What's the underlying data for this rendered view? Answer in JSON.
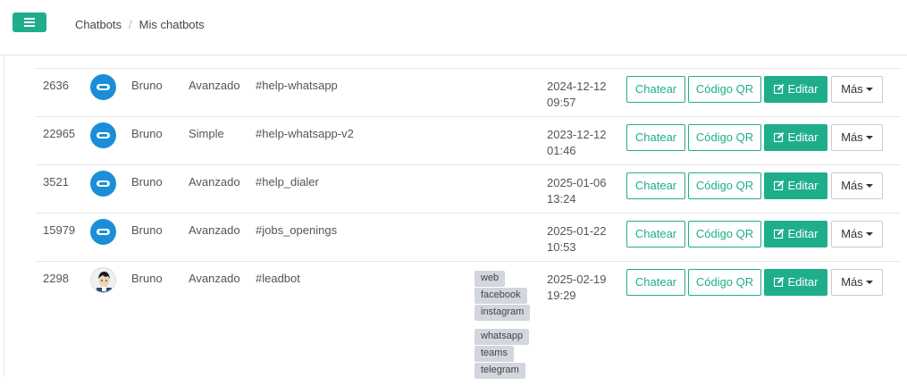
{
  "breadcrumb": {
    "root": "Chatbots",
    "sep": "/",
    "current": "Mis chatbots"
  },
  "buttons": {
    "chat": "Chatear",
    "qr": "Código QR",
    "edit": "Editar",
    "more": "Más"
  },
  "rows": [
    {
      "id": "2636",
      "user": "Bruno",
      "type": "Avanzado",
      "name": "#help-whatsapp",
      "date": "2024-12-12",
      "time": "09:57",
      "avatar": "bot-icon"
    },
    {
      "id": "22965",
      "user": "Bruno",
      "type": "Simple",
      "name": "#help-whatsapp-v2",
      "date": "2023-12-12",
      "time": "01:46",
      "avatar": "bot-icon"
    },
    {
      "id": "3521",
      "user": "Bruno",
      "type": "Avanzado",
      "name": "#help_dialer",
      "date": "2025-01-06",
      "time": "13:24",
      "avatar": "bot-icon"
    },
    {
      "id": "15979",
      "user": "Bruno",
      "type": "Avanzado",
      "name": "#jobs_openings",
      "date": "2025-01-22",
      "time": "10:53",
      "avatar": "bot-icon"
    },
    {
      "id": "2298",
      "user": "Bruno",
      "type": "Avanzado",
      "name": "#leadbot",
      "date": "2025-02-19",
      "time": "19:29",
      "avatar": "person-avatar",
      "tags": [
        "web",
        "facebook",
        "instagram",
        "whatsapp",
        "teams",
        "telegram"
      ]
    }
  ],
  "colors": {
    "accent": "#1fae8c",
    "bot": "#1a8fd6",
    "tag": "#d2d6de"
  }
}
